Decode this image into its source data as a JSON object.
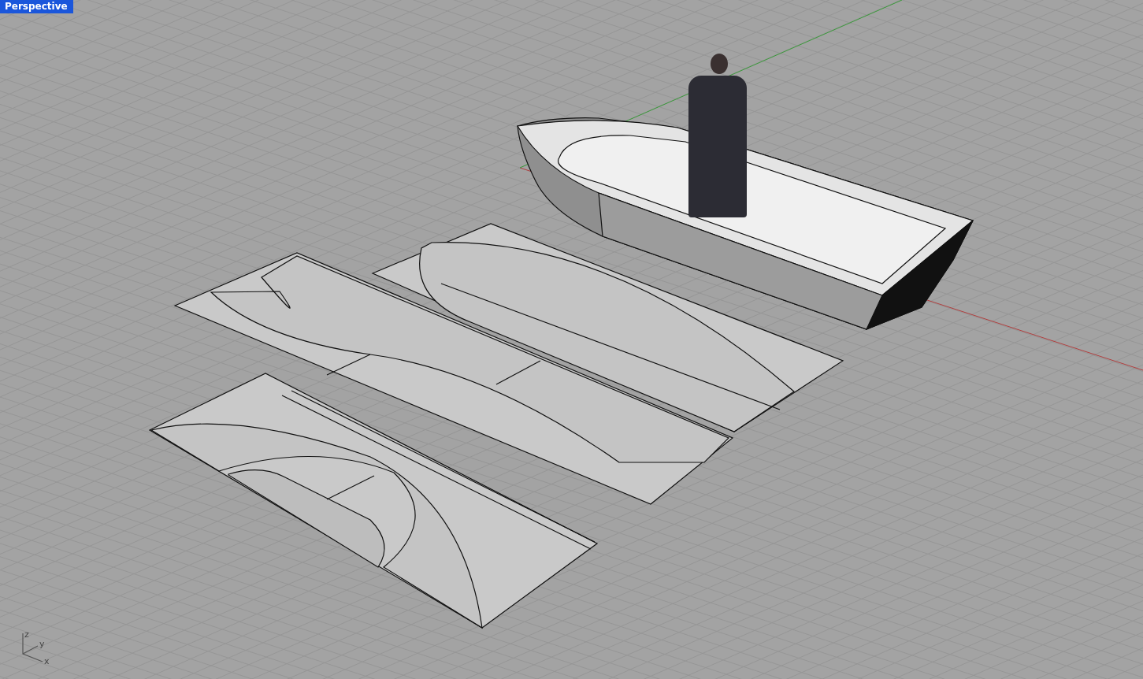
{
  "viewport": {
    "title": "Perspective"
  },
  "axis_gizmo": {
    "labels": [
      "z",
      "y",
      "x"
    ]
  }
}
